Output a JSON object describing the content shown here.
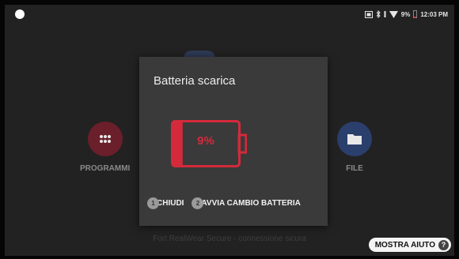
{
  "status_bar": {
    "battery_percent": "9%",
    "time": "12:03 PM",
    "icons": [
      "screenshot-icon",
      "bluetooth-icon",
      "signal-icon",
      "wifi-icon",
      "battery-low-icon"
    ]
  },
  "home": {
    "apps": [
      {
        "label": "PROGRAMMI",
        "icon": "apps-grid-icon",
        "color": "#6a1f2a"
      },
      {
        "label": "FILE",
        "icon": "folder-icon",
        "color": "#2a3f6c"
      }
    ],
    "footer_text": "Fort RealWear Secure - connessione sicura",
    "help_button_label": "MOSTRA AIUTO",
    "help_icon_glyph": "?"
  },
  "dialog": {
    "title": "Batteria scarica",
    "battery_level_label": "9%",
    "battery_level": 0.09,
    "accent_color": "#d42a3b",
    "actions": [
      {
        "badge": "1",
        "label": "CHIUDI"
      },
      {
        "badge": "2",
        "label": "AVVIA CAMBIO BATTERIA"
      }
    ]
  }
}
